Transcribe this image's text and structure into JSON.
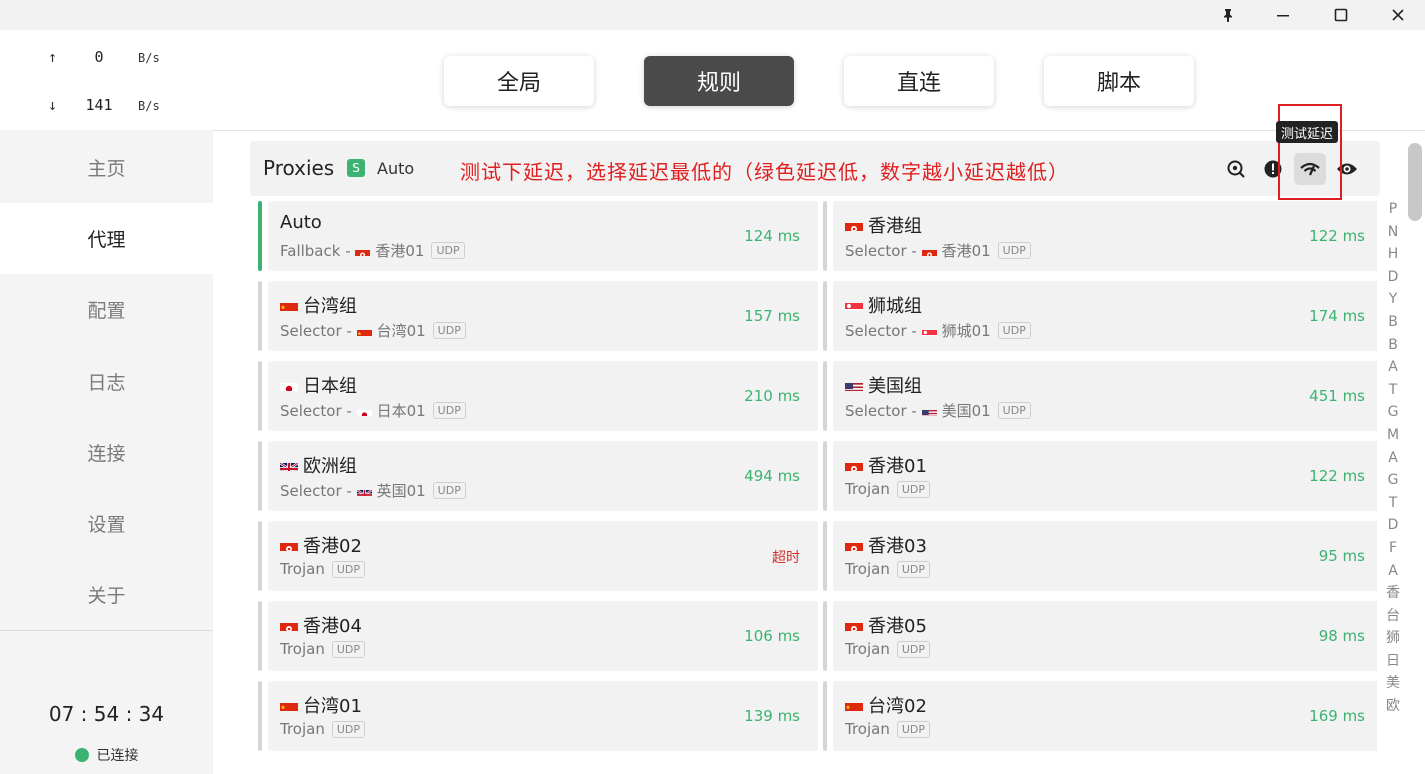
{
  "window": {
    "controls": [
      "pin-icon",
      "minimize-icon",
      "maximize-icon",
      "close-icon"
    ]
  },
  "traffic": {
    "up_arrow": "↑",
    "up_value": "0",
    "up_unit": "B/s",
    "down_arrow": "↓",
    "down_value": "141",
    "down_unit": "B/s"
  },
  "nav": {
    "items": [
      {
        "label": "主页",
        "active": false
      },
      {
        "label": "代理",
        "active": true
      },
      {
        "label": "配置",
        "active": false
      },
      {
        "label": "日志",
        "active": false
      },
      {
        "label": "连接",
        "active": false
      },
      {
        "label": "设置",
        "active": false
      },
      {
        "label": "关于",
        "active": false
      }
    ]
  },
  "clock": "07 : 54 : 34",
  "connection_status": "已连接",
  "modes": [
    {
      "label": "全局",
      "active": false
    },
    {
      "label": "规则",
      "active": true
    },
    {
      "label": "直连",
      "active": false
    },
    {
      "label": "脚本",
      "active": false
    }
  ],
  "proxies_header": {
    "title": "Proxies",
    "badge": "S",
    "selected": "Auto",
    "annotation": "测试下延迟，选择延迟最低的（绿色延迟低，数字越小延迟越低）",
    "tooltip": "测试延迟",
    "icons": [
      "search-location-icon",
      "alert-icon",
      "speed-test-icon",
      "eye-icon"
    ]
  },
  "colors": {
    "accent": "#3cb371",
    "timeout": "#d32f2f",
    "annotation": "#e02020"
  },
  "cards": [
    {
      "name": "Auto",
      "flag": "",
      "type": "Fallback",
      "via": "香港01",
      "via_flag": "hk",
      "udp": "UDP",
      "delay": "124 ms",
      "selected": true
    },
    {
      "name": "香港组",
      "flag": "hk",
      "type": "Selector",
      "via": "香港01",
      "via_flag": "hk",
      "udp": "UDP",
      "delay": "122 ms"
    },
    {
      "name": "台湾组",
      "flag": "tw",
      "type": "Selector",
      "via": "台湾01",
      "via_flag": "tw",
      "udp": "UDP",
      "delay": "157 ms"
    },
    {
      "name": "狮城组",
      "flag": "sg",
      "type": "Selector",
      "via": "狮城01",
      "via_flag": "sg",
      "udp": "UDP",
      "delay": "174 ms"
    },
    {
      "name": "日本组",
      "flag": "jp",
      "type": "Selector",
      "via": "日本01",
      "via_flag": "jp",
      "udp": "UDP",
      "delay": "210 ms"
    },
    {
      "name": "美国组",
      "flag": "us",
      "type": "Selector",
      "via": "美国01",
      "via_flag": "us",
      "udp": "UDP",
      "delay": "451 ms"
    },
    {
      "name": "欧洲组",
      "flag": "uk",
      "type": "Selector",
      "via": "英国01",
      "via_flag": "uk",
      "udp": "UDP",
      "delay": "494 ms"
    },
    {
      "name": "香港01",
      "flag": "hk",
      "type": "Trojan",
      "via": "",
      "via_flag": "",
      "udp": "UDP",
      "delay": "122 ms"
    },
    {
      "name": "香港02",
      "flag": "hk",
      "type": "Trojan",
      "via": "",
      "via_flag": "",
      "udp": "UDP",
      "delay": "超时",
      "timeout": true
    },
    {
      "name": "香港03",
      "flag": "hk",
      "type": "Trojan",
      "via": "",
      "via_flag": "",
      "udp": "UDP",
      "delay": "95 ms"
    },
    {
      "name": "香港04",
      "flag": "hk",
      "type": "Trojan",
      "via": "",
      "via_flag": "",
      "udp": "UDP",
      "delay": "106 ms"
    },
    {
      "name": "香港05",
      "flag": "hk",
      "type": "Trojan",
      "via": "",
      "via_flag": "",
      "udp": "UDP",
      "delay": "98 ms"
    },
    {
      "name": "台湾01",
      "flag": "tw",
      "type": "Trojan",
      "via": "",
      "via_flag": "",
      "udp": "UDP",
      "delay": "139 ms"
    },
    {
      "name": "台湾02",
      "flag": "tw",
      "type": "Trojan",
      "via": "",
      "via_flag": "",
      "udp": "UDP",
      "delay": "169 ms"
    }
  ],
  "index_rail": [
    "P",
    "N",
    "H",
    "D",
    "Y",
    "B",
    "B",
    "A",
    "T",
    "G",
    "M",
    "A",
    "G",
    "T",
    "D",
    "F",
    "A",
    "香",
    "台",
    "狮",
    "日",
    "美",
    "欧"
  ]
}
